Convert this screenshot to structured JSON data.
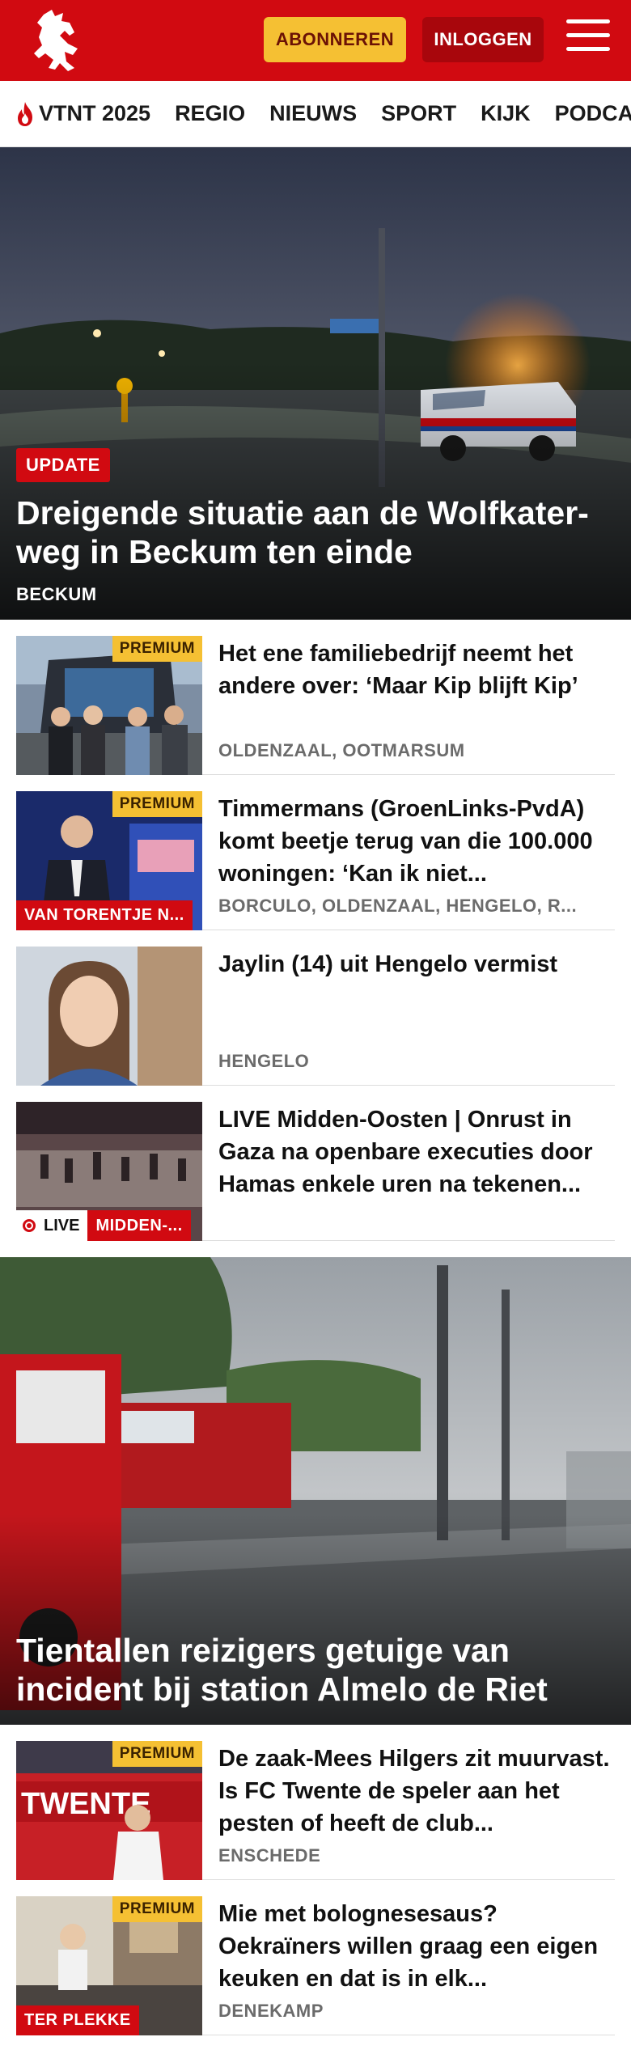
{
  "header": {
    "subscribe_label": "ABONNEREN",
    "login_label": "INLOGGEN"
  },
  "nav": {
    "items": [
      "VTNT 2025",
      "REGIO",
      "NIEUWS",
      "SPORT",
      "KIJK",
      "PODCAST"
    ]
  },
  "hero": {
    "badge": "UPDATE",
    "title": "Dreigende situatie aan de Wolfkater-weg in Beckum ten einde",
    "location": "BECKUM"
  },
  "articles": [
    {
      "premium": "PREMIUM",
      "title": "Het ene familiebedrijf neemt het andere over: ‘Maar Kip blijft Kip’",
      "location": "OLDENZAAL, OOTMARSUM"
    },
    {
      "premium": "PREMIUM",
      "tag": "VAN TORENTJE N...",
      "title": "Timmermans (GroenLinks-PvdA) komt beetje terug van die 100.000 woningen: ‘Kan ik niet...",
      "location": "BORCULO, OLDENZAAL, HENGELO, R..."
    },
    {
      "title": "Jaylin (14) uit Hengelo vermist",
      "location": "HENGELO"
    },
    {
      "live": "LIVE",
      "tag": "MIDDEN-...",
      "title": "LIVE Midden-Oosten | Onrust in Gaza na openbare executies door Hamas enkele uren na tekenen..."
    }
  ],
  "hero2": {
    "title": "Tientallen reizigers getuige van incident bij station Almelo de Riet"
  },
  "articles2": [
    {
      "premium": "PREMIUM",
      "title": "De zaak-Mees Hilgers zit muurvast. Is FC Twente de speler aan het pesten of heeft de club...",
      "location": "ENSCHEDE"
    },
    {
      "premium": "PREMIUM",
      "tag": "TER PLEKKE",
      "title": "Mie met bolognesesaus? Oekraïners willen graag een eigen keuken en dat is in elk...",
      "location": "DENEKAMP"
    }
  ],
  "colors": {
    "brand_red": "#d10a11",
    "premium_yellow": "#f5c033",
    "meta_gray": "#6b6b6b"
  },
  "icons": [
    "horse-logo-icon",
    "hamburger-menu-icon",
    "flame-icon",
    "live-dot-icon"
  ]
}
